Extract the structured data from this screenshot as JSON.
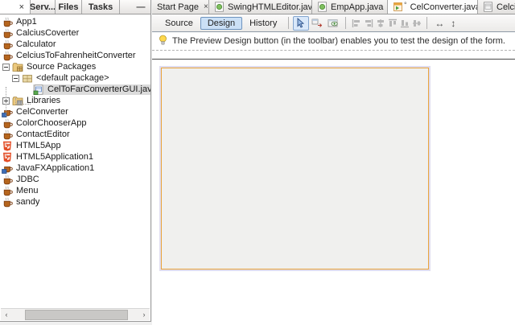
{
  "left_panel": {
    "tabbar": {
      "active_tab_close": "×",
      "tabs": [
        "Serv...",
        "Files",
        "Tasks"
      ],
      "minimize_label": "—"
    },
    "tree": {
      "items": [
        {
          "label": "App1",
          "icon": "java-project-icon"
        },
        {
          "label": "CalciusCoverter",
          "icon": "java-project-icon"
        },
        {
          "label": "Calculator",
          "icon": "java-project-icon"
        },
        {
          "label": "CelciusToFahrenheitConverter",
          "icon": "java-project-icon"
        },
        {
          "label": "Source Packages",
          "icon": "source-packages-folder-icon",
          "expanded": true
        },
        {
          "label": "<default package>",
          "icon": "package-icon",
          "expanded": true
        },
        {
          "label": "CelToFarConverterGUI.java",
          "icon": "java-form-file-icon",
          "selected": true
        },
        {
          "label": "Libraries",
          "icon": "libraries-folder-icon",
          "expanded": false
        },
        {
          "label": "CelConverter",
          "icon": "javafx-project-icon"
        },
        {
          "label": "ColorChooserApp",
          "icon": "java-project-icon"
        },
        {
          "label": "ContactEditor",
          "icon": "java-project-icon"
        },
        {
          "label": "HTML5App",
          "icon": "html5-project-icon"
        },
        {
          "label": "HTML5Application1",
          "icon": "html5-project-icon"
        },
        {
          "label": "JavaFXApplication1",
          "icon": "javafx-project-icon"
        },
        {
          "label": "JDBC",
          "icon": "java-project-icon"
        },
        {
          "label": "Menu",
          "icon": "java-project-icon"
        },
        {
          "label": "sandy",
          "icon": "java-project-icon"
        }
      ]
    },
    "hscroll": {
      "left_arrow": "‹",
      "right_arrow": "›"
    }
  },
  "editor": {
    "tabs": [
      {
        "label": "Start Page",
        "close": "×"
      },
      {
        "label": "SwingHTMLEditor.java",
        "close": "×"
      },
      {
        "label": "EmpApp.java",
        "close": "×"
      },
      {
        "label": "CelConverter.java",
        "close": "×",
        "badge": "°",
        "active": true
      },
      {
        "label": "Celci"
      }
    ],
    "toolbar": {
      "source_label": "Source",
      "design_label": "Design",
      "history_label": "History",
      "horizontal_resize_label": "↔",
      "vertical_resize_label": "↕"
    },
    "hint_text": "The Preview Design button (in the toolbar) enables you to test the design of the form."
  },
  "colors": {
    "form_border": "#e9a43c",
    "form_fill": "#f0f0ee",
    "design_active_bg": "#cbe0f6",
    "selection_bg": "#dbdbdb"
  }
}
